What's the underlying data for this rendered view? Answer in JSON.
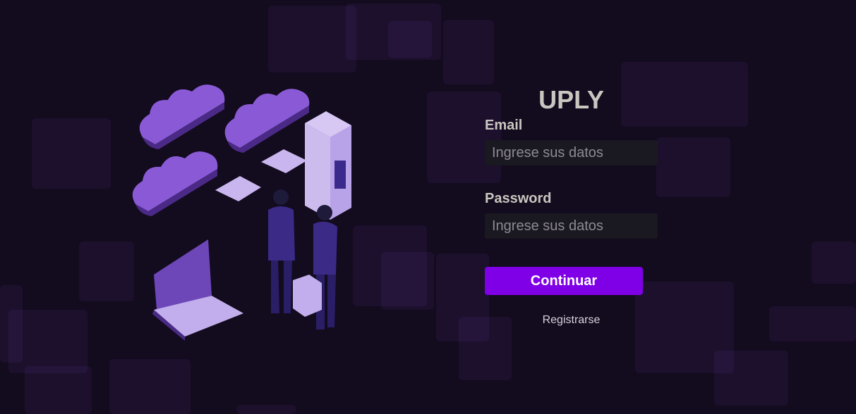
{
  "app": {
    "title": "UPLY"
  },
  "login": {
    "email_label": "Email",
    "email_placeholder": "Ingrese sus datos",
    "password_label": "Password",
    "password_placeholder": "Ingrese sus datos",
    "submit_label": "Continuar",
    "register_label": "Registrarse"
  },
  "colors": {
    "background": "#130b1e",
    "accent": "#7f00e6",
    "label_text": "#c9c6c0",
    "input_bg": "#1a1820"
  },
  "icons": {
    "illustration": "cloud-server-business-illustration"
  }
}
